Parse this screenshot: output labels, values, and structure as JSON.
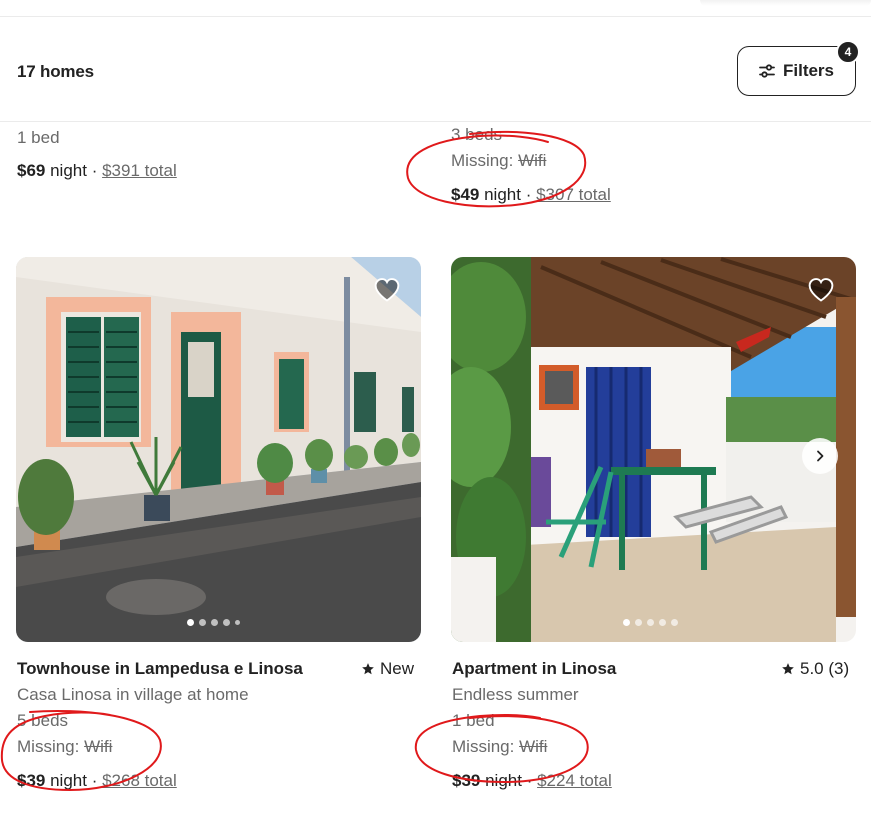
{
  "header": {
    "homes_count": "17 homes",
    "filters_label": "Filters",
    "filters_badge": "4"
  },
  "top_listings": [
    {
      "beds": "1 bed",
      "price": "$69",
      "per": " night",
      "sep": " · ",
      "total": "$391 total"
    },
    {
      "beds": "3 beds",
      "missing_prefix": "Missing: ",
      "missing_item": "Wifi",
      "price": "$49",
      "per": " night",
      "sep": " · ",
      "total": "$307 total"
    }
  ],
  "cards": [
    {
      "title": "Townhouse in Lampedusa e Linosa",
      "rating": "New",
      "subtitle": "Casa Linosa in village at home",
      "beds": "5 beds",
      "missing_prefix": "Missing: ",
      "missing_item": "Wifi",
      "price": "$39",
      "per": " night",
      "sep": " · ",
      "total": "$268 total",
      "photo_dots": 5,
      "active_dot": 0
    },
    {
      "title": "Apartment in Linosa",
      "rating": "5.0 (3)",
      "subtitle": "Endless summer",
      "beds": "1 bed",
      "missing_prefix": "Missing: ",
      "missing_item": "Wifi",
      "price": "$39",
      "per": " night",
      "sep": " · ",
      "total": "$224 total",
      "photo_dots": 5,
      "active_dot": 0
    }
  ],
  "icons": {
    "filters": "sliders-icon",
    "heart": "heart-icon",
    "star": "star-icon",
    "next": "chevron-right-icon"
  },
  "colors": {
    "text": "#222222",
    "secondary": "#6a6a6a",
    "annotation": "#e0191b"
  }
}
